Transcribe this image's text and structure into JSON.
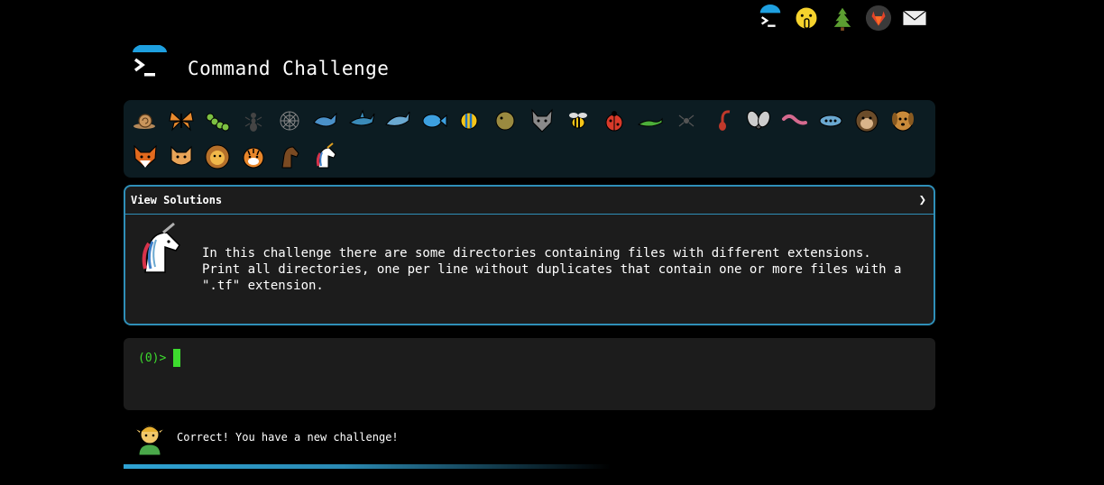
{
  "header": {
    "title": "Command Challenge"
  },
  "topbar": {
    "icons": [
      "terminal-logo-icon",
      "shushing-face-icon",
      "tree-icon",
      "gitlab-icon",
      "mail-icon"
    ]
  },
  "animals": {
    "row1": [
      "snail",
      "butterfly",
      "caterpillar",
      "ant",
      "spider-web",
      "whale",
      "shark",
      "dolphin",
      "fish",
      "tropical-fish",
      "blowfish",
      "wolf",
      "bee",
      "ladybug",
      "lizard",
      "spider",
      "scorpion",
      "fly",
      "worm",
      "microbe",
      "monkey",
      "dog"
    ],
    "row2": [
      "fox",
      "cat",
      "lion",
      "tiger",
      "horse",
      "unicorn"
    ]
  },
  "solutions": {
    "header": "View Solutions",
    "chevron": "❯",
    "description": "In this challenge there are some directories containing files with different extensions.\nPrint all directories, one per line without duplicates that contain one or more files with a\n\".tf\" extension."
  },
  "terminal": {
    "prompt": "(0)>"
  },
  "status": {
    "message": "Correct! You have a new challenge!"
  },
  "progress": {
    "fraction": 0.6
  },
  "colors": {
    "accent": "#2f8fb8",
    "prompt": "#3ddc2e",
    "panel": "#0c1c22"
  }
}
